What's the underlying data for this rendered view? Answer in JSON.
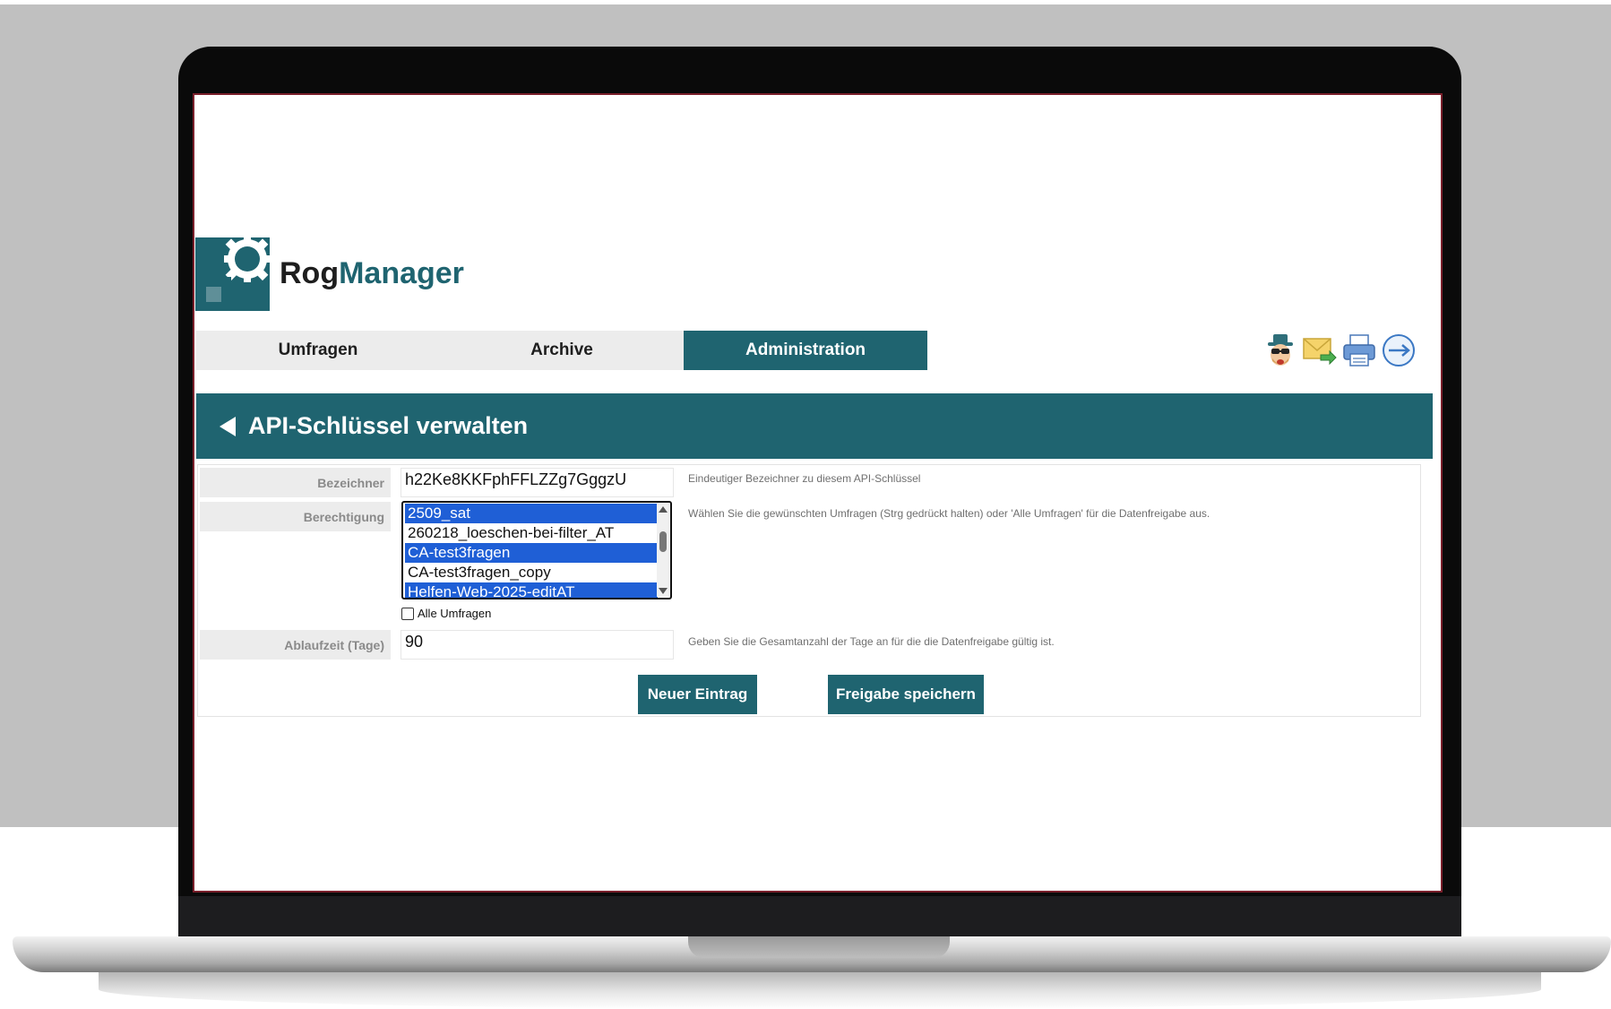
{
  "brand": {
    "part1": "Rog",
    "part2": "Manager"
  },
  "nav": {
    "tabs": [
      {
        "label": "Umfragen",
        "active": false
      },
      {
        "label": "Archive",
        "active": false
      },
      {
        "label": "Administration",
        "active": true
      }
    ]
  },
  "toolbar_icons": [
    "incognito-agent-icon",
    "mail-forward-icon",
    "printer-icon",
    "logout-arrow-icon"
  ],
  "header": {
    "title": "API-Schlüssel verwalten"
  },
  "form": {
    "bezeichner": {
      "label": "Bezeichner",
      "value": "h22Ke8KKFphFFLZZg7GggzU",
      "hint": "Eindeutiger Bezeichner zu diesem API-Schlüssel"
    },
    "berechtigung": {
      "label": "Berechtigung",
      "hint": "Wählen Sie die gewünschten Umfragen (Strg gedrückt halten) oder 'Alle Umfragen' für die Datenfreigabe aus.",
      "options": [
        {
          "label": "2509_sat",
          "selected": true
        },
        {
          "label": "260218_loeschen-bei-filter_AT",
          "selected": false
        },
        {
          "label": "CA-test3fragen",
          "selected": true
        },
        {
          "label": "CA-test3fragen_copy",
          "selected": false
        },
        {
          "label": "Helfen-Web-2025-editAT",
          "selected": true
        }
      ],
      "all_label": "Alle Umfragen",
      "all_checked": false
    },
    "ablaufzeit": {
      "label": "Ablaufzeit (Tage)",
      "value": "90",
      "hint": "Geben Sie die Gesamtanzahl der Tage an für die die Datenfreigabe gültig ist."
    }
  },
  "buttons": {
    "new_entry": "Neuer Eintrag",
    "save": "Freigabe speichern"
  },
  "colors": {
    "accent": "#1f6470",
    "selection": "#1f5fd6",
    "label_bg": "#ececec"
  }
}
